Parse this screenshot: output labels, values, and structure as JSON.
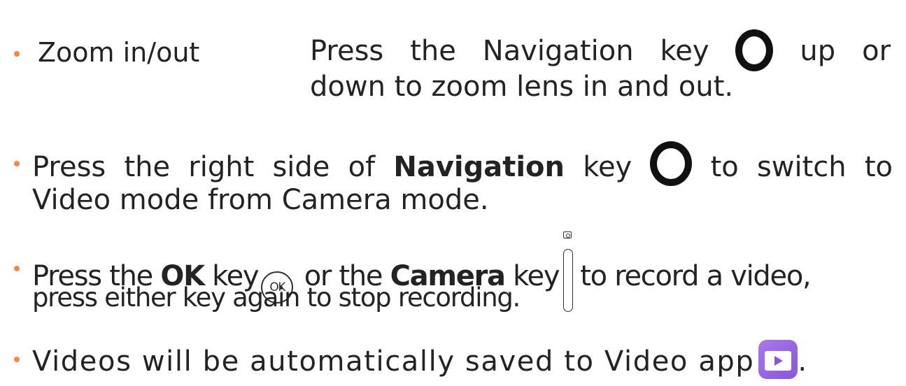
{
  "zoom": {
    "label": "Zoom in/out",
    "line1_before": "Press the Navigation key",
    "line1_after": "up or",
    "line2": "down to zoom lens in and out.",
    "icon": "navigation-key-icon"
  },
  "switch_mode": {
    "line1_before": "Press the right side of ",
    "line1_bold": "Navigation",
    "line1_mid": " key",
    "line1_after": "to switch to",
    "line2": "Video mode from Camera mode.",
    "icon": "navigation-key-icon"
  },
  "record": {
    "line1_a": "Press the ",
    "ok_bold": "OK",
    "line1_b": " key",
    "ok_key_text": "OK",
    "line1_c": " or the ",
    "camera_bold": "Camera",
    "line1_d": " key",
    "line1_e": "to record a video,",
    "line2": "press either key again to stop recording.",
    "icons": [
      "ok-key-icon",
      "camera-key-icon"
    ]
  },
  "save": {
    "text": "Videos will be automatically saved to Video app",
    "period": ".",
    "icon": "video-app-icon",
    "icon_color": "#9a66e4"
  },
  "colors": {
    "bullet": "#f0884a",
    "text": "#232323"
  }
}
